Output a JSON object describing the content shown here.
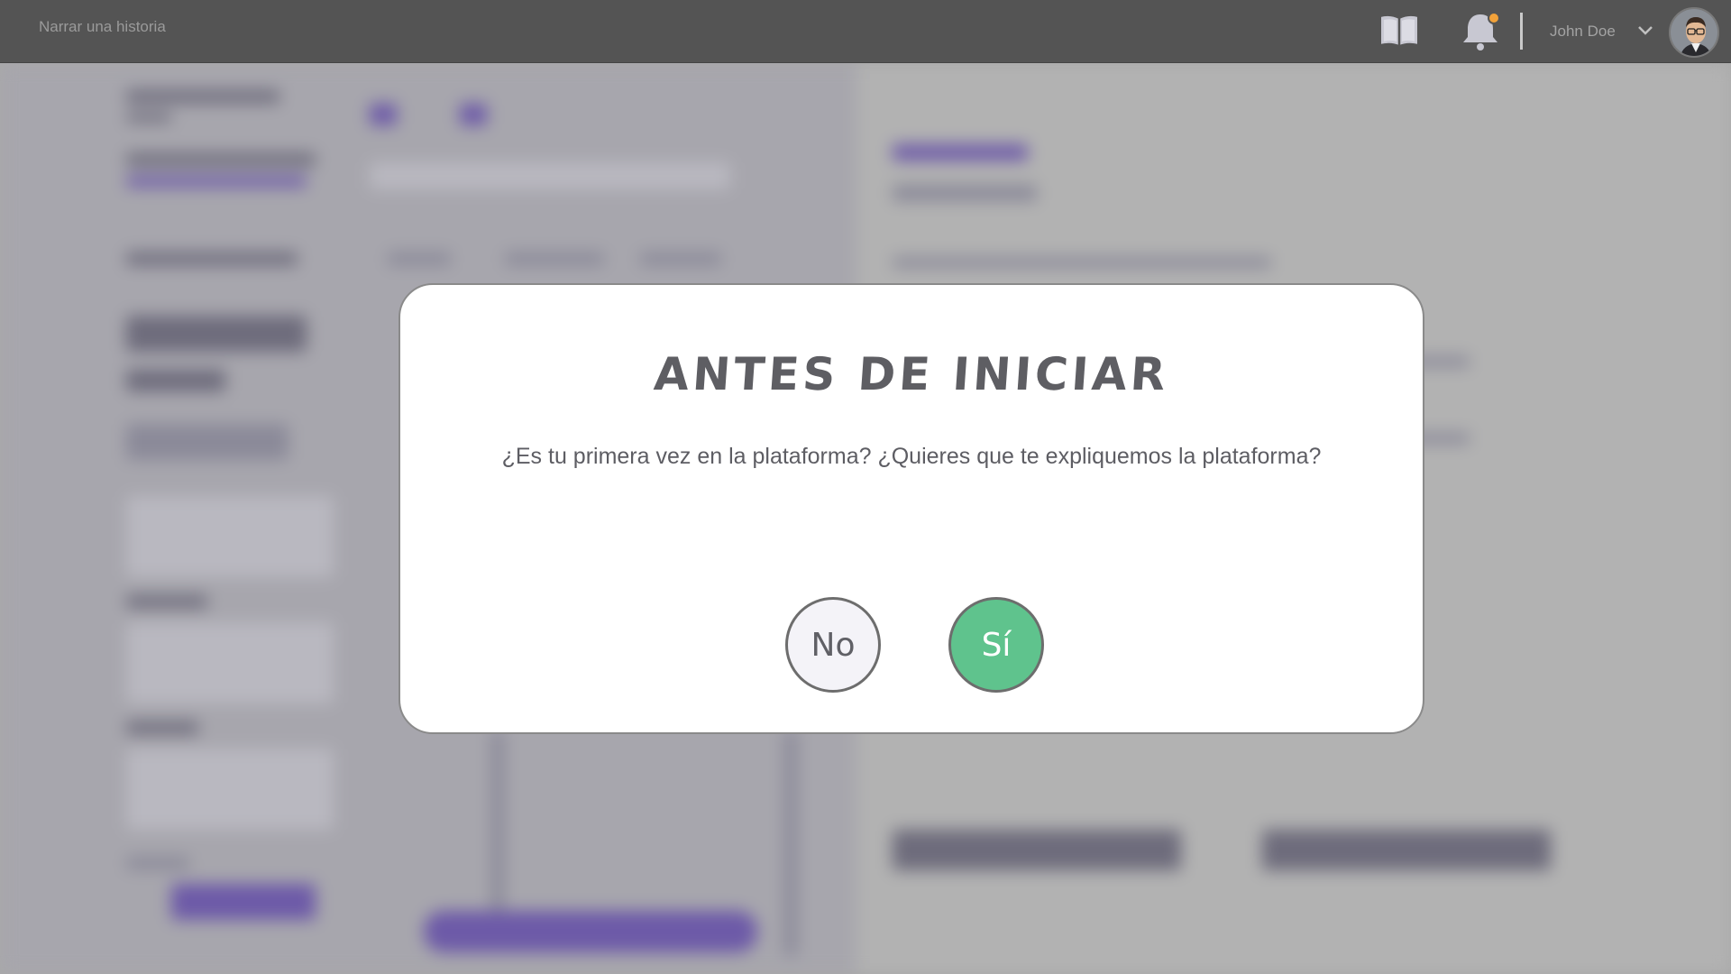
{
  "header": {
    "app_title": "Narrar una historia",
    "book_icon": "book-icon",
    "bell_icon": "bell-icon",
    "notification_color": "#f2a23a",
    "user_name": "John Doe",
    "chevron_icon": "chevron-down-icon"
  },
  "modal": {
    "title": "ANTES DE INICIAR",
    "message": "¿Es tu primera vez en la plataforma? ¿Quieres que te expliquemos la plataforma?",
    "no_label": "No",
    "yes_label": "Sí",
    "yes_color": "#5fc38d"
  }
}
